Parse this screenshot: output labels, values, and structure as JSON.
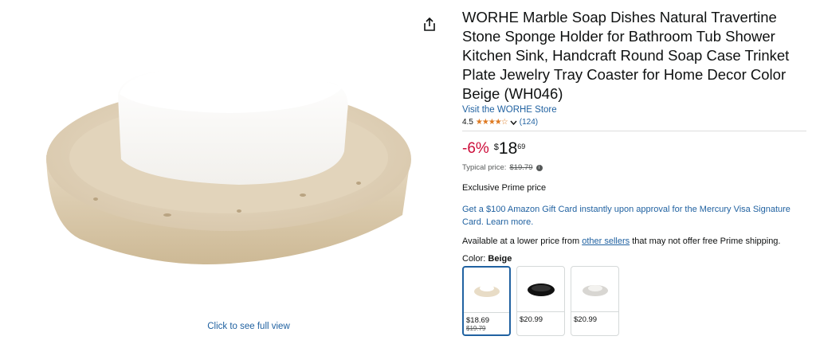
{
  "gallery": {
    "caption": "Click to see full view"
  },
  "product": {
    "title": "WORHE Marble Soap Dishes Natural Travertine Stone Sponge Holder for Bathroom Tub Shower Kitchen Sink, Handcraft Round Soap Case Trinket Plate Jewelry Tray Coaster for Home Decor Color Beige (WH046)",
    "store_link": "Visit the WORHE Store",
    "rating_value": "4.5",
    "stars": "★★★★☆",
    "rating_count": "(124)"
  },
  "price": {
    "discount": "-6%",
    "currency": "$",
    "whole": "18",
    "fraction": "69",
    "typical_label": "Typical price:",
    "typical_value": "$19.79"
  },
  "promo": {
    "exclusive": "Exclusive Prime price",
    "gift_card": "Get a $100 Amazon Gift Card instantly upon approval for the Mercury Visa Signature Card. Learn more.",
    "avail_prefix": "Available at a lower price from",
    "avail_link": "other sellers",
    "avail_suffix": "that may not offer free Prime shipping."
  },
  "color": {
    "label": "Color:",
    "selected": "Beige",
    "options": [
      {
        "price": "$18.69",
        "old_price": "$19.79",
        "tone": "#e8dcc6"
      },
      {
        "price": "$20.99",
        "old_price": "",
        "tone": "#111111"
      },
      {
        "price": "$20.99",
        "old_price": "",
        "tone": "#d8d6d2"
      }
    ]
  }
}
